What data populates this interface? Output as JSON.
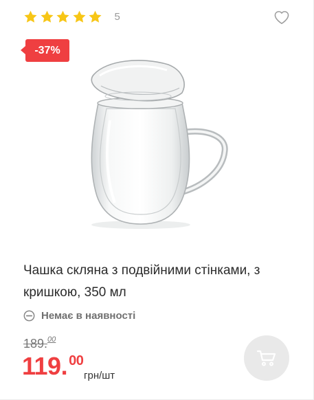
{
  "product": {
    "rating": {
      "stars": 5,
      "count": "5"
    },
    "discount_badge": "-37%",
    "title": "Чашка скляна з подвійними стінками, з кришкою, 350 мл",
    "stock_status": "Немає в наявності",
    "old_price": {
      "integer": "189.",
      "decimal": "00"
    },
    "new_price": {
      "integer": "119.",
      "decimal": "00"
    },
    "unit": "грн/шт"
  },
  "colors": {
    "star": "#f7c616",
    "badge": "#ef3f41",
    "price": "#ef3f41",
    "cart_button_bg": "#e9e9e9"
  },
  "icons": {
    "wishlist": "heart-outline-icon",
    "stock": "minus-circle-icon",
    "cart": "shopping-cart-icon",
    "star": "star-icon"
  }
}
